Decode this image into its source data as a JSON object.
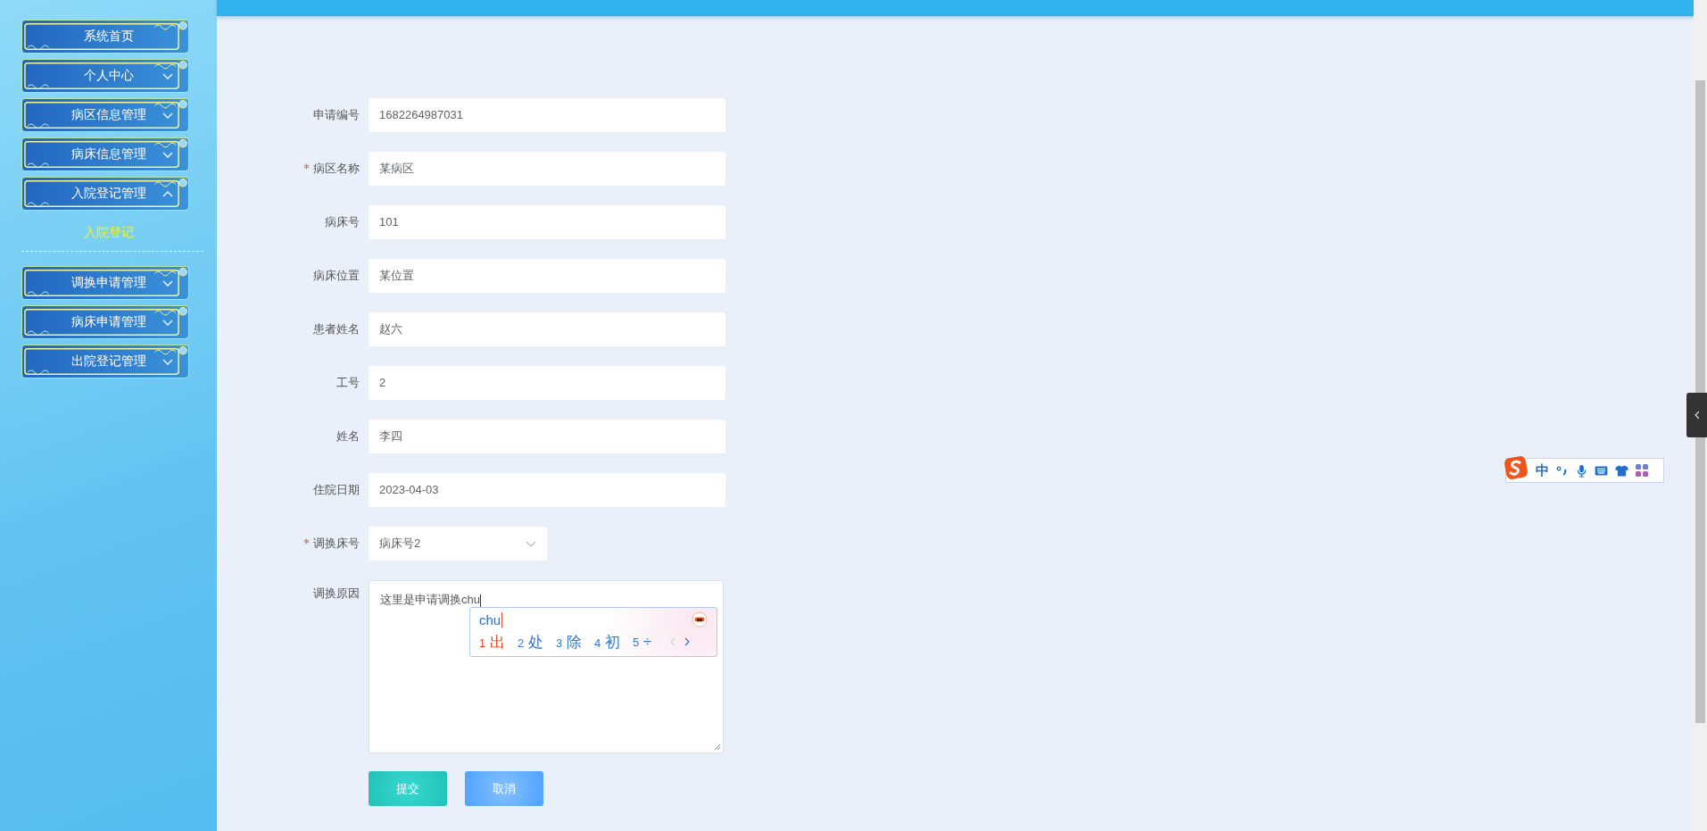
{
  "sidebar": {
    "items": [
      {
        "label": "系统首页",
        "kind": "link"
      },
      {
        "label": "个人中心",
        "kind": "menu",
        "expanded": false
      },
      {
        "label": "病区信息管理",
        "kind": "menu",
        "expanded": false
      },
      {
        "label": "病床信息管理",
        "kind": "menu",
        "expanded": false
      },
      {
        "label": "入院登记管理",
        "kind": "menu",
        "expanded": true,
        "children": [
          {
            "label": "入院登记",
            "selected": true
          }
        ]
      },
      {
        "label": "调换申请管理",
        "kind": "menu",
        "expanded": false
      },
      {
        "label": "病床申请管理",
        "kind": "menu",
        "expanded": false
      },
      {
        "label": "出院登记管理",
        "kind": "menu",
        "expanded": false
      }
    ]
  },
  "form": {
    "fields": [
      {
        "label": "申请编号",
        "kind": "input",
        "required": false,
        "value": "1682264987031"
      },
      {
        "label": "病区名称",
        "kind": "input",
        "required": true,
        "value": "某病区"
      },
      {
        "label": "病床号",
        "kind": "input",
        "required": false,
        "value": "101"
      },
      {
        "label": "病床位置",
        "kind": "input",
        "required": false,
        "value": "某位置"
      },
      {
        "label": "患者姓名",
        "kind": "input",
        "required": false,
        "value": "赵六"
      },
      {
        "label": "工号",
        "kind": "input",
        "required": false,
        "value": "2"
      },
      {
        "label": "姓名",
        "kind": "input",
        "required": false,
        "value": "李四"
      },
      {
        "label": "住院日期",
        "kind": "input",
        "required": false,
        "value": "2023-04-03"
      },
      {
        "label": "调换床号",
        "kind": "select",
        "required": true,
        "value": "病床号2"
      },
      {
        "label": "调换原因",
        "kind": "textarea",
        "required": false,
        "value": "这里是申请调换chu"
      }
    ],
    "buttons": [
      {
        "label": "提交",
        "kind": "primary"
      },
      {
        "label": "取消",
        "kind": "secondary"
      }
    ]
  },
  "ime": {
    "composition": "chu",
    "candidates": [
      {
        "number": "1",
        "text": "出",
        "selected": true
      },
      {
        "number": "2",
        "text": "处",
        "selected": false
      },
      {
        "number": "3",
        "text": "除",
        "selected": false
      },
      {
        "number": "4",
        "text": "初",
        "selected": false
      },
      {
        "number": "5",
        "text": "÷",
        "selected": false
      }
    ]
  },
  "ime_toolbar": {
    "mode": "中"
  }
}
